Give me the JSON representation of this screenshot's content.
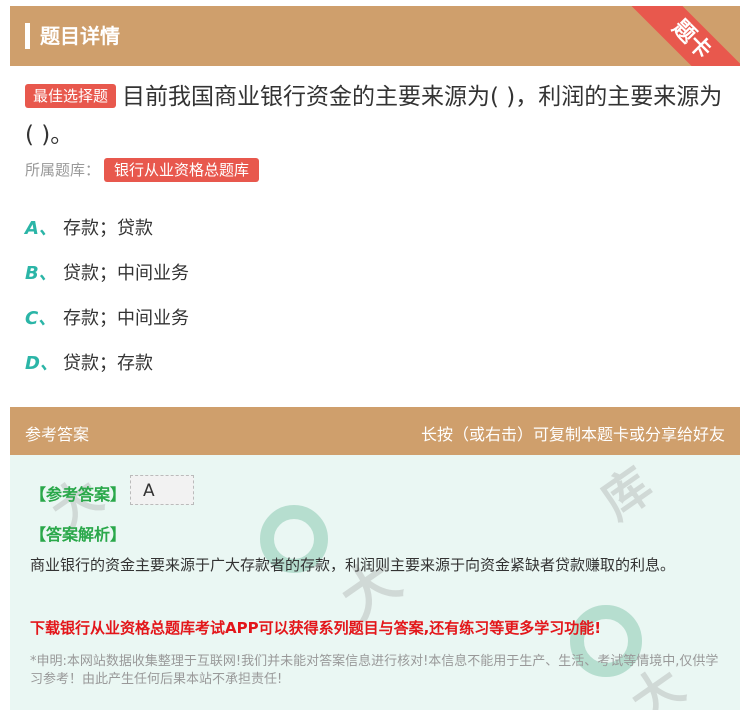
{
  "header": {
    "title": "题目详情",
    "ribbon": "题卡"
  },
  "question": {
    "tag": "最佳选择题",
    "text": "目前我国商业银行资金的主要来源为( )，利润的主要来源为( )。",
    "bank_label": "所属题库：",
    "bank_tag": "银行从业资格总题库"
  },
  "options": [
    {
      "letter": "A、",
      "text": "存款；贷款"
    },
    {
      "letter": "B、",
      "text": "贷款；中间业务"
    },
    {
      "letter": "C、",
      "text": "存款；中间业务"
    },
    {
      "letter": "D、",
      "text": "贷款；存款"
    }
  ],
  "answer_section": {
    "title": "参考答案",
    "hint": "长按（或右击）可复制本题卡或分享给好友",
    "ref_label": "【参考答案】",
    "ref_value": "A",
    "analysis_label": "【答案解析】",
    "analysis_text": "商业银行的资金主要来源于广大存款者的存款，利润则主要来源于向资金紧缺者贷款赚取的利息。",
    "promo": "下载银行从业资格总题库考试APP可以获得系列题目与答案,还有练习等更多学习功能!",
    "disclaimer": "*申明:本网站数据收集整理于互联网!我们并未能对答案信息进行核对!本信息不能用于生产、生活、考试等情境中,仅供学习参考！由此产生任何后果本站不承担责任!"
  },
  "colors": {
    "accent": "#cf9f6c",
    "tag_red": "#e8584d",
    "option_letter": "#2bb5a7",
    "answer_green": "#2aa84a",
    "promo_red": "#e3161a"
  }
}
